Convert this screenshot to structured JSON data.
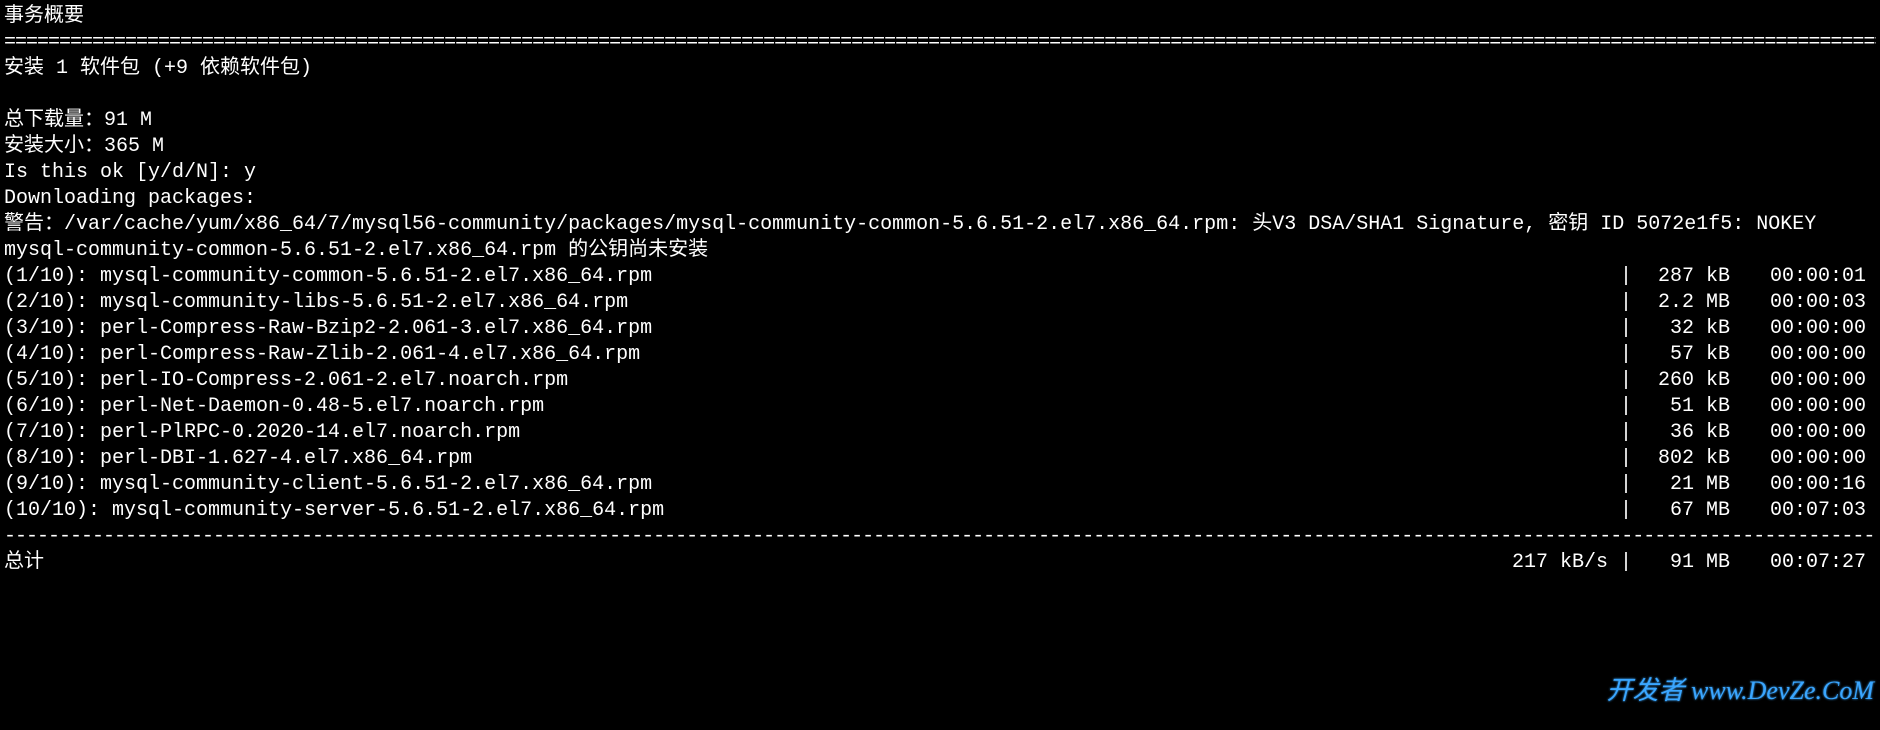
{
  "header": {
    "title": "事务概要",
    "divider": "============================================================================================================================================================================================"
  },
  "install_line": "安装  1 软件包 (+9 依赖软件包)",
  "summary": {
    "download_total": "总下载量：91 M",
    "install_size": "安装大小：365 M",
    "confirm_prompt": "Is this ok [y/d/N]: y",
    "downloading": "Downloading packages:",
    "warning": "警告：/var/cache/yum/x86_64/7/mysql56-community/packages/mysql-community-common-5.6.51-2.el7.x86_64.rpm: 头V3 DSA/SHA1 Signature, 密钥 ID 5072e1f5: NOKEY",
    "pubkey_notice": "mysql-community-common-5.6.51-2.el7.x86_64.rpm 的公钥尚未安装"
  },
  "downloads": [
    {
      "index": "(1/10): mysql-community-common-5.6.51-2.el7.x86_64.rpm",
      "size": "287 kB",
      "time": "00:00:01"
    },
    {
      "index": "(2/10): mysql-community-libs-5.6.51-2.el7.x86_64.rpm",
      "size": "2.2 MB",
      "time": "00:00:03"
    },
    {
      "index": "(3/10): perl-Compress-Raw-Bzip2-2.061-3.el7.x86_64.rpm",
      "size": "32 kB",
      "time": "00:00:00"
    },
    {
      "index": "(4/10): perl-Compress-Raw-Zlib-2.061-4.el7.x86_64.rpm",
      "size": "57 kB",
      "time": "00:00:00"
    },
    {
      "index": "(5/10): perl-IO-Compress-2.061-2.el7.noarch.rpm",
      "size": "260 kB",
      "time": "00:00:00"
    },
    {
      "index": "(6/10): perl-Net-Daemon-0.48-5.el7.noarch.rpm",
      "size": "51 kB",
      "time": "00:00:00"
    },
    {
      "index": "(7/10): perl-PlRPC-0.2020-14.el7.noarch.rpm",
      "size": "36 kB",
      "time": "00:00:00"
    },
    {
      "index": "(8/10): perl-DBI-1.627-4.el7.x86_64.rpm",
      "size": "802 kB",
      "time": "00:00:00"
    },
    {
      "index": "(9/10): mysql-community-client-5.6.51-2.el7.x86_64.rpm",
      "size": "21 MB",
      "time": "00:00:16"
    },
    {
      "index": "(10/10): mysql-community-server-5.6.51-2.el7.x86_64.rpm",
      "size": "67 MB",
      "time": "00:07:03"
    }
  ],
  "footer": {
    "divider": "--------------------------------------------------------------------------------------------------------------------------------------------------------------------------------------------",
    "total_label": "总计",
    "speed": "217 kB/s",
    "total_size": "91 MB",
    "total_time": "00:07:27"
  },
  "pipe": "|",
  "watermark": "开发者 www.DevZe.CoM"
}
